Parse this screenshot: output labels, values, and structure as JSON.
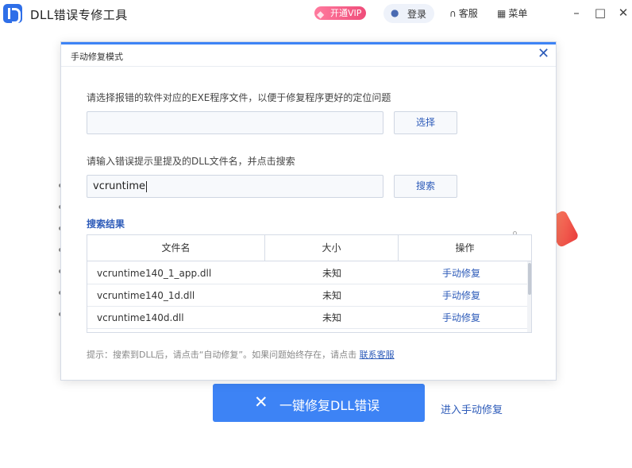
{
  "titlebar": {
    "app_title": "DLL错误专修工具",
    "vip_label": "开通VIP",
    "login_label": "登录",
    "service_label": "客服",
    "menu_label": "菜单"
  },
  "background": {
    "fix_button_label": "一键修复DLL错误",
    "manual_link_label": "进入手动修复"
  },
  "modal": {
    "title": "手动修复模式",
    "exe_prompt": "请选择报错的软件对应的EXE程序文件，以便于修复程序更好的定位问题",
    "exe_input_value": "",
    "select_button": "选择",
    "dll_prompt": "请输入错误提示里提及的DLL文件名，并点击搜索",
    "dll_input_value": "vcruntime",
    "search_button": "搜索",
    "results_title": "搜索结果",
    "table": {
      "headers": [
        "文件名",
        "大小",
        "操作"
      ],
      "rows": [
        {
          "name": "vcruntime140_1_app.dll",
          "size": "未知",
          "action": "手动修复"
        },
        {
          "name": "vcruntime140_1d.dll",
          "size": "未知",
          "action": "手动修复"
        },
        {
          "name": "vcruntime140d.dll",
          "size": "未知",
          "action": "手动修复"
        }
      ]
    },
    "tip_text": "提示：搜索到DLL后，请点击“自动修复”。如果问题始终存在，请点击",
    "tip_link": "联系客服"
  },
  "colors": {
    "accent": "#3d83f5",
    "link": "#2d5bb9",
    "vip": "#ef4d7a"
  },
  "icons": {
    "logo": "dll-logo-icon",
    "vip": "diamond-icon",
    "login": "user-icon",
    "service": "headset-icon",
    "menu": "grid-icon",
    "fix": "tools-icon"
  }
}
